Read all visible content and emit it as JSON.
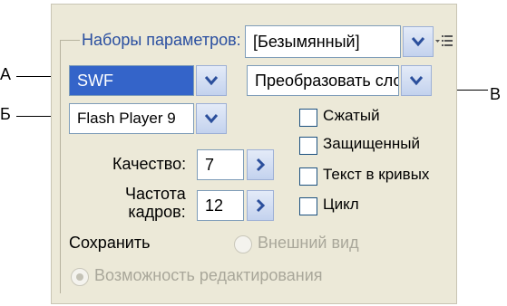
{
  "panel": {
    "preset_group_label": "Наборы параметров:",
    "preset_value": "[Безымянный]",
    "format_value": "SWF",
    "player_value": "Flash Player 9",
    "layers_value": "Преобразовать слои",
    "quality_label": "Качество:",
    "quality_value": "7",
    "framerate_label_line1": "Частота",
    "framerate_label_line2": "кадров:",
    "framerate_value": "12",
    "checkboxes": [
      {
        "label": "Сжатый",
        "checked": false
      },
      {
        "label": "Защищенный",
        "checked": false
      },
      {
        "label": "Текст в кривых",
        "checked": false
      },
      {
        "label": "Цикл",
        "checked": false
      }
    ],
    "save_label": "Сохранить",
    "radio_appearance": "Внешний вид",
    "radio_editability": "Возможность редактирования"
  },
  "callouts": {
    "a": "А",
    "b": "Б",
    "v": "В"
  },
  "colors": {
    "panel_bg": "#ece9d8",
    "legend_text": "#2a4fa0",
    "selection": "#3464c9",
    "arrow": "#2b4f9c"
  },
  "icons": {
    "dropdown": "chevron-down-icon",
    "stepper": "chevron-right-icon",
    "menu": "panel-menu-icon"
  }
}
